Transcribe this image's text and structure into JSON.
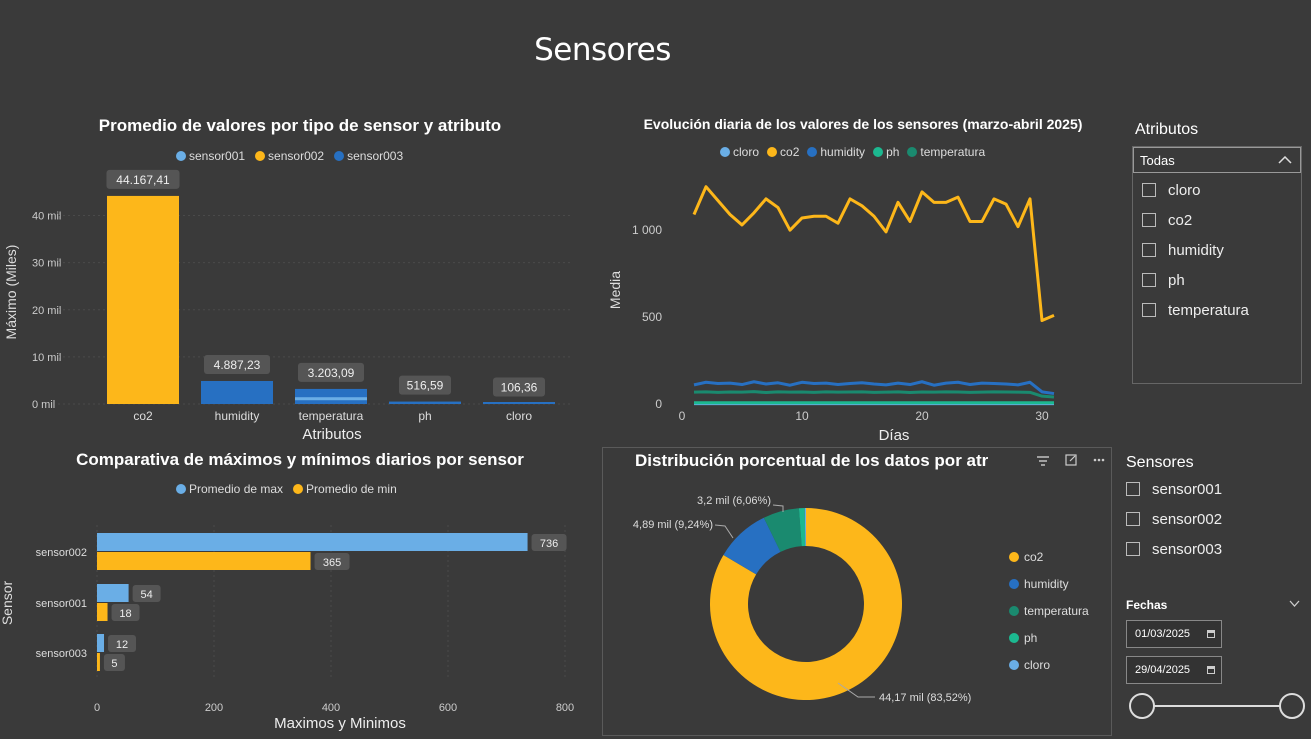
{
  "page": {
    "title": "Sensores"
  },
  "colors": {
    "blue_light": "#6aaee6",
    "yellow": "#fdb71a",
    "blue_dark": "#2770c2",
    "teal": "#1a8a6f",
    "green": "#1cb890",
    "bg": "#3a3a3a"
  },
  "bar_chart": {
    "title": "Promedio de valores por tipo de sensor y atributo",
    "legend": [
      "sensor001",
      "sensor002",
      "sensor003"
    ],
    "ylabel": "Máximo (Miles)",
    "xlabel": "Atributos",
    "yticks": [
      "40 mil",
      "30 mil",
      "20 mil",
      "10 mil",
      "0 mil"
    ],
    "categories": [
      "co2",
      "humidity",
      "temperatura",
      "ph",
      "cloro"
    ],
    "data_labels": [
      "44.167,41",
      "4.887,23",
      "3.203,09",
      "516,59",
      "106,36"
    ]
  },
  "line_chart": {
    "title": "Evolución diaria de los valores de los sensores (marzo-abril 2025)",
    "legend": [
      "cloro",
      "co2",
      "humidity",
      "ph",
      "temperatura"
    ],
    "ylabel": "Media",
    "xlabel": "Días",
    "yticks": [
      "1 000",
      "500",
      "0"
    ],
    "xticks": [
      "0",
      "10",
      "20",
      "30"
    ]
  },
  "hbar_chart": {
    "title": "Comparativa de máximos y mínimos diarios por sensor",
    "legend": [
      "Promedio de max",
      "Promedio de min"
    ],
    "ylabel": "Sensor",
    "xlabel": "Maximos y Minimos",
    "xticks": [
      "0",
      "200",
      "400",
      "600",
      "800"
    ],
    "categories": [
      "sensor002",
      "sensor001",
      "sensor003"
    ],
    "max_labels": [
      "736",
      "54",
      "12"
    ],
    "min_labels": [
      "365",
      "18",
      "5"
    ]
  },
  "donut_chart": {
    "title": "Distribución porcentual de los datos por atr",
    "legend": [
      "co2",
      "humidity",
      "temperatura",
      "ph",
      "cloro"
    ],
    "labels": [
      "44,17 mil (83,52%)",
      "4,89 mil (9,24%)",
      "3,2 mil (6,06%)"
    ]
  },
  "slicer_atributos": {
    "title": "Atributos",
    "selected": "Todas",
    "options": [
      "cloro",
      "co2",
      "humidity",
      "ph",
      "temperatura"
    ]
  },
  "slicer_sensores": {
    "title": "Sensores",
    "options": [
      "sensor001",
      "sensor002",
      "sensor003"
    ]
  },
  "slicer_fechas": {
    "title": "Fechas",
    "start": "01/03/2025",
    "end": "29/04/2025"
  },
  "chart_data": [
    {
      "type": "bar",
      "title": "Promedio de valores por tipo de sensor y atributo",
      "xlabel": "Atributos",
      "ylabel": "Máximo (Miles)",
      "categories": [
        "co2",
        "humidity",
        "temperatura",
        "ph",
        "cloro"
      ],
      "series": [
        {
          "name": "sensor001",
          "values": [
            0,
            0,
            0,
            0,
            0
          ]
        },
        {
          "name": "sensor002",
          "values": [
            44167.41,
            0,
            0,
            0,
            0
          ]
        },
        {
          "name": "sensor003",
          "values": [
            0,
            4887.23,
            3203.09,
            516.59,
            106.36
          ]
        }
      ],
      "ylim": [
        0,
        45000
      ],
      "legend": "top"
    },
    {
      "type": "line",
      "title": "Evolución diaria de los valores de los sensores (marzo-abril 2025)",
      "xlabel": "Días",
      "ylabel": "Media",
      "ylim": [
        0,
        1300
      ],
      "xlim": [
        0,
        33
      ],
      "x": [
        1,
        2,
        3,
        4,
        5,
        6,
        7,
        8,
        9,
        10,
        11,
        12,
        13,
        14,
        15,
        16,
        17,
        18,
        19,
        20,
        21,
        22,
        23,
        24,
        25,
        26,
        27,
        28,
        29,
        30,
        31
      ],
      "series": [
        {
          "name": "co2",
          "values": [
            1090,
            1250,
            1170,
            1090,
            1030,
            1100,
            1180,
            1130,
            1000,
            1070,
            1080,
            1080,
            1040,
            1180,
            1140,
            1080,
            990,
            1160,
            1050,
            1220,
            1160,
            1160,
            1190,
            1050,
            1050,
            1180,
            1150,
            1020,
            1180,
            480,
            510
          ]
        },
        {
          "name": "humidity",
          "values": [
            110,
            125,
            118,
            120,
            112,
            128,
            115,
            122,
            108,
            125,
            118,
            120,
            112,
            118,
            122,
            115,
            110,
            120,
            112,
            128,
            108,
            120,
            125,
            112,
            120,
            118,
            115,
            110,
            125,
            70,
            60
          ]
        },
        {
          "name": "temperatura",
          "values": [
            68,
            70,
            67,
            69,
            68,
            71,
            66,
            70,
            68,
            69,
            67,
            70,
            68,
            69,
            70,
            67,
            68,
            70,
            66,
            69,
            68,
            70,
            69,
            67,
            68,
            70,
            69,
            68,
            67,
            45,
            40
          ]
        },
        {
          "name": "ph",
          "values": [
            7,
            7,
            7,
            7,
            7,
            7,
            7,
            7,
            7,
            7,
            7,
            7,
            7,
            7,
            7,
            7,
            7,
            7,
            7,
            7,
            7,
            7,
            7,
            7,
            7,
            7,
            7,
            7,
            7,
            7,
            7
          ]
        },
        {
          "name": "cloro",
          "values": [
            2,
            2,
            2,
            2,
            2,
            2,
            2,
            2,
            2,
            2,
            2,
            2,
            2,
            2,
            2,
            2,
            2,
            2,
            2,
            2,
            2,
            2,
            2,
            2,
            2,
            2,
            2,
            2,
            2,
            2,
            2
          ]
        }
      ],
      "legend": "top"
    },
    {
      "type": "bar",
      "orientation": "horizontal",
      "title": "Comparativa de máximos y mínimos diarios por sensor",
      "xlabel": "Maximos y Minimos",
      "ylabel": "Sensor",
      "categories": [
        "sensor002",
        "sensor001",
        "sensor003"
      ],
      "series": [
        {
          "name": "Promedio de max",
          "values": [
            736,
            54,
            12
          ]
        },
        {
          "name": "Promedio de min",
          "values": [
            365,
            18,
            5
          ]
        }
      ],
      "xlim": [
        0,
        800
      ],
      "legend": "top"
    },
    {
      "type": "pie",
      "donut": true,
      "title": "Distribución porcentual de los datos por atr",
      "categories": [
        "co2",
        "humidity",
        "temperatura",
        "ph",
        "cloro"
      ],
      "values": [
        44167.41,
        4887.23,
        3203.09,
        516.59,
        106.36
      ],
      "percent": [
        83.52,
        9.24,
        6.06,
        0.98,
        0.2
      ],
      "legend": "right"
    }
  ]
}
